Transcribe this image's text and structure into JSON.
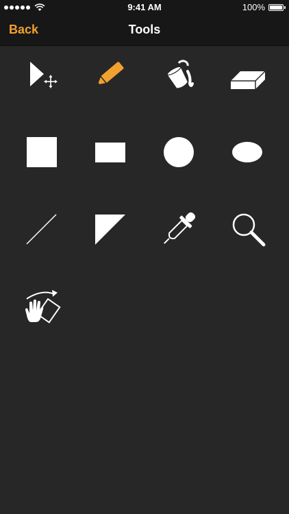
{
  "status_bar": {
    "time": "9:41 AM",
    "battery": "100%",
    "battery_level": 1.0,
    "signal_bars": 5
  },
  "nav": {
    "back_label": "Back",
    "title": "Tools"
  },
  "tools": [
    {
      "icon": "select-move-icon"
    },
    {
      "icon": "pencil-icon",
      "selected": true
    },
    {
      "icon": "paint-bucket-icon"
    },
    {
      "icon": "eraser-icon"
    },
    {
      "icon": "square-icon"
    },
    {
      "icon": "rectangle-icon"
    },
    {
      "icon": "circle-icon"
    },
    {
      "icon": "ellipse-icon"
    },
    {
      "icon": "line-icon"
    },
    {
      "icon": "triangle-icon"
    },
    {
      "icon": "eyedropper-icon"
    },
    {
      "icon": "magnifier-icon"
    },
    {
      "icon": "hand-pan-rotate-icon"
    }
  ],
  "colors": {
    "accent": "#f2a030",
    "background": "#272727",
    "bar": "#171717",
    "icon": "#ffffff"
  }
}
